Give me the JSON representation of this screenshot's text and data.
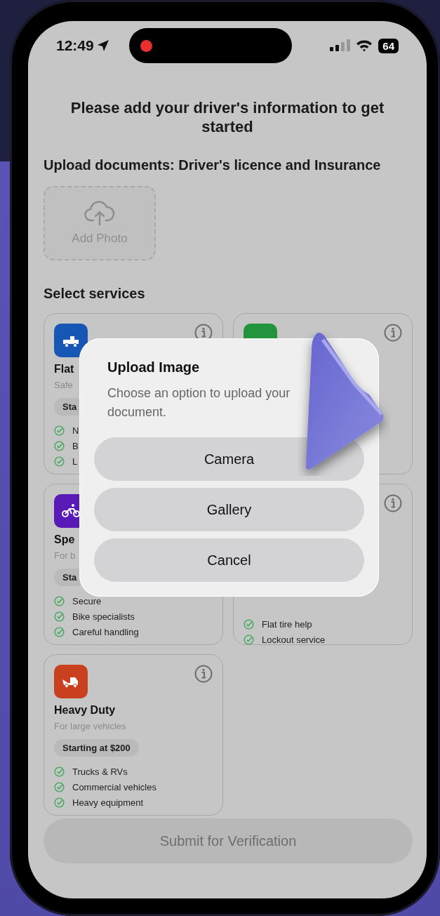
{
  "status_bar": {
    "time": "12:49",
    "battery": "64"
  },
  "heading": "Please add your driver's information to get started",
  "upload": {
    "label": "Upload documents: Driver's licence and Insurance",
    "add_photo": "Add Photo"
  },
  "services": {
    "label": "Select services",
    "cards": [
      {
        "kind": "flatbed",
        "info": true,
        "color": "#1656b5",
        "title": "Flat",
        "subtitle": "Safe",
        "price": "Sta",
        "features": [
          "N",
          "B",
          "L"
        ]
      },
      {
        "kind": "blank",
        "info": true,
        "color": "#22943e"
      },
      {
        "kind": "bike",
        "color": "#5a1ab8",
        "title": "Spe",
        "subtitle": "For b",
        "price": "Sta",
        "features": [
          "Secure",
          "Bike specialists",
          "Careful handling"
        ]
      },
      {
        "kind": "blank",
        "info": true,
        "features": [
          "Flat tire help",
          "Lockout service"
        ]
      },
      {
        "kind": "tow",
        "info": true,
        "color": "#c8401e",
        "title": "Heavy Duty",
        "subtitle": "For large vehicles",
        "price": "Starting at $200",
        "features": [
          "Trucks & RVs",
          "Commercial vehicles",
          "Heavy equipment"
        ]
      }
    ]
  },
  "submit": {
    "label": "Submit for Verification",
    "disabled": true
  },
  "dialog": {
    "title": "Upload Image",
    "message": "Choose an option to upload your document.",
    "buttons": [
      "Camera",
      "Gallery",
      "Cancel"
    ]
  }
}
